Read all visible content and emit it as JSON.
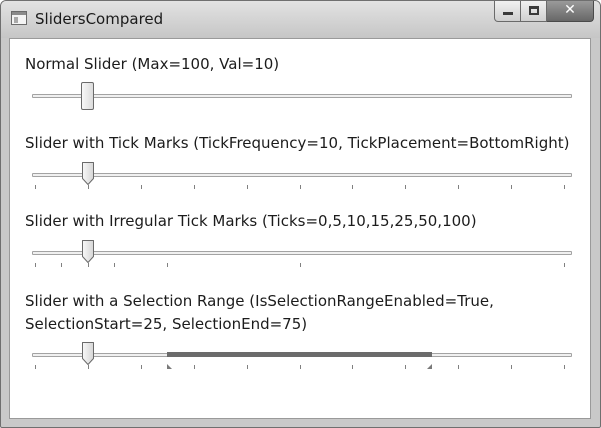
{
  "window": {
    "title": "SlidersCompared",
    "controls": {
      "minimize": "–",
      "maximize": "□",
      "close": "✕"
    }
  },
  "sliders": [
    {
      "label": "Normal Slider (Max=100, Val=10)",
      "minimum": 0,
      "maximum": 100,
      "value": 10,
      "thumb": "rectangle",
      "ticks": []
    },
    {
      "label": "Slider with Tick Marks (TickFrequency=10, TickPlacement=BottomRight)",
      "minimum": 0,
      "maximum": 100,
      "value": 10,
      "thumb": "pointer",
      "ticks": [
        0,
        10,
        20,
        30,
        40,
        50,
        60,
        70,
        80,
        90,
        100
      ]
    },
    {
      "label": "Slider with Irregular Tick Marks (Ticks=0,5,10,15,25,50,100)",
      "minimum": 0,
      "maximum": 100,
      "value": 10,
      "thumb": "pointer",
      "ticks": [
        0,
        5,
        10,
        15,
        25,
        50,
        100
      ]
    },
    {
      "label_line1": "Slider with a Selection Range (IsSelectionRangeEnabled=True,",
      "label_line2": "SelectionStart=25, SelectionEnd=75)",
      "minimum": 0,
      "maximum": 100,
      "value": 10,
      "thumb": "pointer",
      "ticks": [
        0,
        10,
        20,
        30,
        40,
        50,
        60,
        70,
        80,
        90,
        100
      ],
      "selection_start": 25,
      "selection_end": 75
    }
  ],
  "colors": {
    "selection_range": "#6b6b6b",
    "tick": "#808080",
    "thumb_border": "#6a6a6a"
  }
}
